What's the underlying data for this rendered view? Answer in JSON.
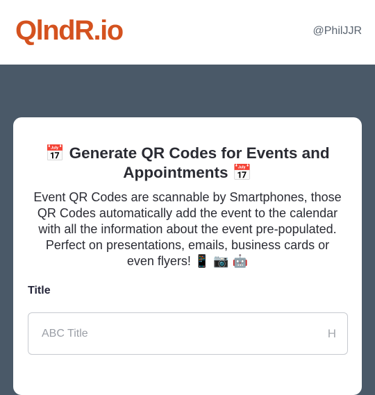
{
  "header": {
    "logo": "QlndR.io",
    "user": "@PhilJJR"
  },
  "card": {
    "title": "📅 Generate QR Codes for Events and Appointments 📅",
    "description": "Event QR Codes are scannable by Smartphones, those QR Codes automatically add the event to the calendar with all the information about the event pre-populated. Perfect on presentations, emails, business cards or even flyers! 📱 📷 🤖",
    "fields": {
      "title_label": "Title",
      "title_placeholder": "ABC Title",
      "title_hint": "H"
    }
  }
}
